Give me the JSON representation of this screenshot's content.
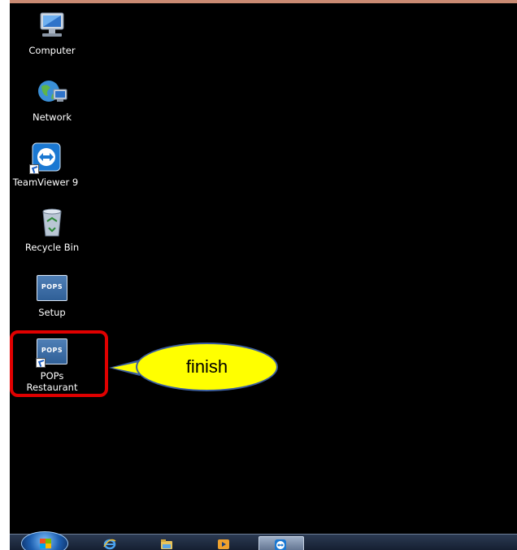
{
  "desktop": {
    "icons": [
      {
        "id": "computer",
        "label": "Computer"
      },
      {
        "id": "network",
        "label": "Network"
      },
      {
        "id": "teamviewer",
        "label": "TeamViewer 9"
      },
      {
        "id": "recycle_bin",
        "label": "Recycle Bin"
      },
      {
        "id": "setup",
        "label": "Setup",
        "badge": "POPS"
      },
      {
        "id": "pops_restaurant",
        "label_line1": "POPs",
        "label_line2": "Restaurant",
        "badge": "POPS"
      }
    ]
  },
  "annotation": {
    "callout_text": "finish",
    "highlight_color": "#e00000",
    "callout_color": "#ffff00"
  },
  "taskbar": {
    "items": [
      "start-orb",
      "internet-explorer-icon",
      "windows-explorer-icon",
      "media-player-icon",
      "teamviewer-icon"
    ]
  },
  "colors": {
    "desktop_background": "#000000",
    "taskbar": "#1a2538"
  }
}
